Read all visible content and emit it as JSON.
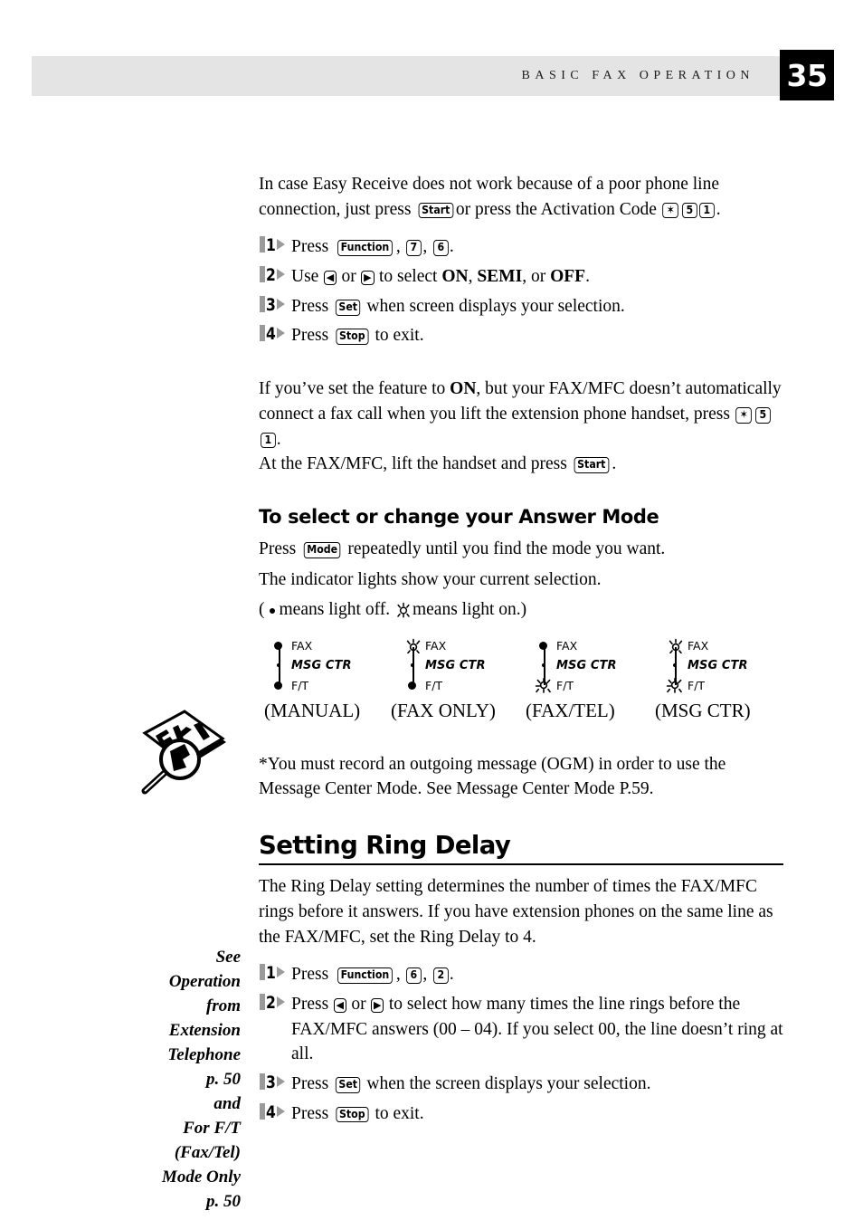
{
  "header": {
    "title": "BASIC FAX OPERATION",
    "page_number": "35"
  },
  "intro": {
    "line_a": "In case Easy Receive does not work because of a poor phone line connection, just",
    "line_b_pre": "press",
    "key_start": "Start",
    "line_b_mid": "or press the Activation Code",
    "key_star": "✶",
    "key_5": "5",
    "key_1": "1",
    "line_b_end": "."
  },
  "steps_easy_receive": [
    {
      "number": "1",
      "pre": "Press",
      "key1": "Function",
      "sep1": ",",
      "key2": "7",
      "sep2": ",",
      "key3": "6",
      "post": "."
    },
    {
      "number": "2",
      "pre": "Use",
      "arrow_left": "◀",
      "mid": "or",
      "arrow_right": "▶",
      "post_a": "to select",
      "opt1": "ON",
      "comma1": ",",
      "opt2": "SEMI",
      "comma2": ", or",
      "opt3": "OFF",
      "post_b": "."
    },
    {
      "number": "3",
      "pre": "Press",
      "key1": "Set",
      "post": "when screen displays your selection."
    },
    {
      "number": "4",
      "pre": "Press",
      "key1": "Stop",
      "post": "to exit."
    }
  ],
  "note_on": {
    "l1_a": "If you’ve set the feature to",
    "l1_bold": "ON",
    "l1_b": ", but your FAX/MFC doesn’t automatically connect",
    "l2_a": "a fax call when you lift the extension phone handset, press",
    "key_star": "✶",
    "key_5": "5",
    "key_1": "1",
    "l2_b": ".",
    "l3_a": "At the FAX/MFC, lift the handset and press",
    "key_start": "Start",
    "l3_b": "."
  },
  "answer_mode": {
    "heading": "To select or change your Answer Mode",
    "line1_pre": "Press",
    "key_mode": "Mode",
    "line1_post": "repeatedly until you find the mode you want.",
    "line2": "The indicator lights show your current selection.",
    "legend_open": "(",
    "legend_off_text": "means light  off.",
    "legend_on_text": "means light  on.)"
  },
  "indicator_groups": [
    {
      "mode": "(MANUAL)",
      "lamps": [
        {
          "label": "FAX",
          "state": "off"
        },
        {
          "label": "MSG CTR",
          "state": "off-small"
        },
        {
          "label": "F/T",
          "state": "off"
        }
      ]
    },
    {
      "mode": "(FAX ONLY)",
      "lamps": [
        {
          "label": "FAX",
          "state": "on"
        },
        {
          "label": "MSG CTR",
          "state": "off-small"
        },
        {
          "label": "F/T",
          "state": "off"
        }
      ]
    },
    {
      "mode": "(FAX/TEL)",
      "lamps": [
        {
          "label": "FAX",
          "state": "off"
        },
        {
          "label": "MSG CTR",
          "state": "off-small"
        },
        {
          "label": "F/T",
          "state": "on"
        }
      ]
    },
    {
      "mode": "(MSG CTR)",
      "lamps": [
        {
          "label": "FAX",
          "state": "on"
        },
        {
          "label": "MSG CTR",
          "state": "off-small"
        },
        {
          "label": "F/T",
          "state": "on"
        }
      ]
    }
  ],
  "footnote": {
    "line1": "*You must record an outgoing message (OGM) in order to use the Message Center",
    "line2": "Mode. See Message Center Mode P.59."
  },
  "ring_delay": {
    "heading": "Setting Ring Delay",
    "body_l1": "The Ring Delay setting determines the number of times the FAX/MFC rings before",
    "body_l2": "it answers. If you have extension phones on the same line as the FAX/MFC, set the",
    "body_l3": "Ring Delay to 4."
  },
  "steps_ring_delay": [
    {
      "number": "1",
      "pre": "Press",
      "key1": "Function",
      "sep1": ",",
      "key2": "6",
      "sep2": ",",
      "key3": "2",
      "post": "."
    },
    {
      "number": "2",
      "pre": "Press",
      "arrow_left": "◀",
      "mid": "or",
      "arrow_right": "▶",
      "post_a": "to select how many times the line rings before the FAX/MFC",
      "post_b": "answers (00 – 04). If you select 00, the line doesn’t ring at all."
    },
    {
      "number": "3",
      "pre": "Press",
      "key1": "Set",
      "post": "when the screen displays your selection."
    },
    {
      "number": "4",
      "pre": "Press",
      "key1": "Stop",
      "post": "to exit."
    }
  ],
  "margin_note": {
    "lines": [
      "See",
      "Operation",
      "from",
      "Extension",
      "Telephone",
      "p. 50",
      "and",
      "For F/T",
      "(Fax/Tel)",
      "Mode Only",
      "p. 50"
    ]
  },
  "colors": {
    "header_bar": "#e4e4e4",
    "page_box": "#000000",
    "step_marker": "#9a9a9a"
  }
}
